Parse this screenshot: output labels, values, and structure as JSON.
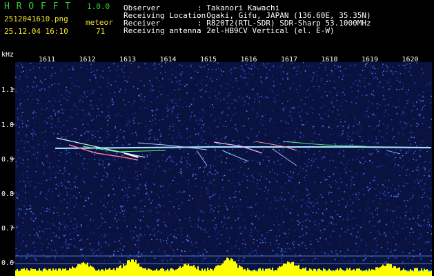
{
  "app": {
    "name": "H R O F F T",
    "version": "1.0.0",
    "filename": "2512041610.png",
    "datetime": "25.12.04 16:10",
    "meteor_label": "meteor",
    "meteor_count": "71"
  },
  "info": [
    {
      "label": "Observer",
      "value": ": Takanori Kawachi"
    },
    {
      "label": "Receiving Location",
      "value": ": Ogaki, Gifu, JAPAN (136.60E, 35.35N)"
    },
    {
      "label": "Receiver",
      "value": ": R820T2(RTL-SDR) SDR-Sharp 53.1000MHz"
    },
    {
      "label": "Receiving antenna",
      "value": ": 2el-HB9CV Vertical (el. E-W)"
    }
  ],
  "axes": {
    "y_unit": "kHz",
    "y_ticks": [
      "1.1",
      "1.0",
      "0.9",
      "0.8",
      "0.7",
      "0.6"
    ],
    "x_ticks": [
      "1611",
      "1612",
      "1613",
      "1614",
      "1615",
      "1616",
      "1617",
      "1618",
      "1619",
      "1620"
    ]
  },
  "colors": {
    "background": "#000000",
    "noise": "#1a2a8a",
    "carrier": "#a8e8ff",
    "baseline": "#ffff00"
  }
}
